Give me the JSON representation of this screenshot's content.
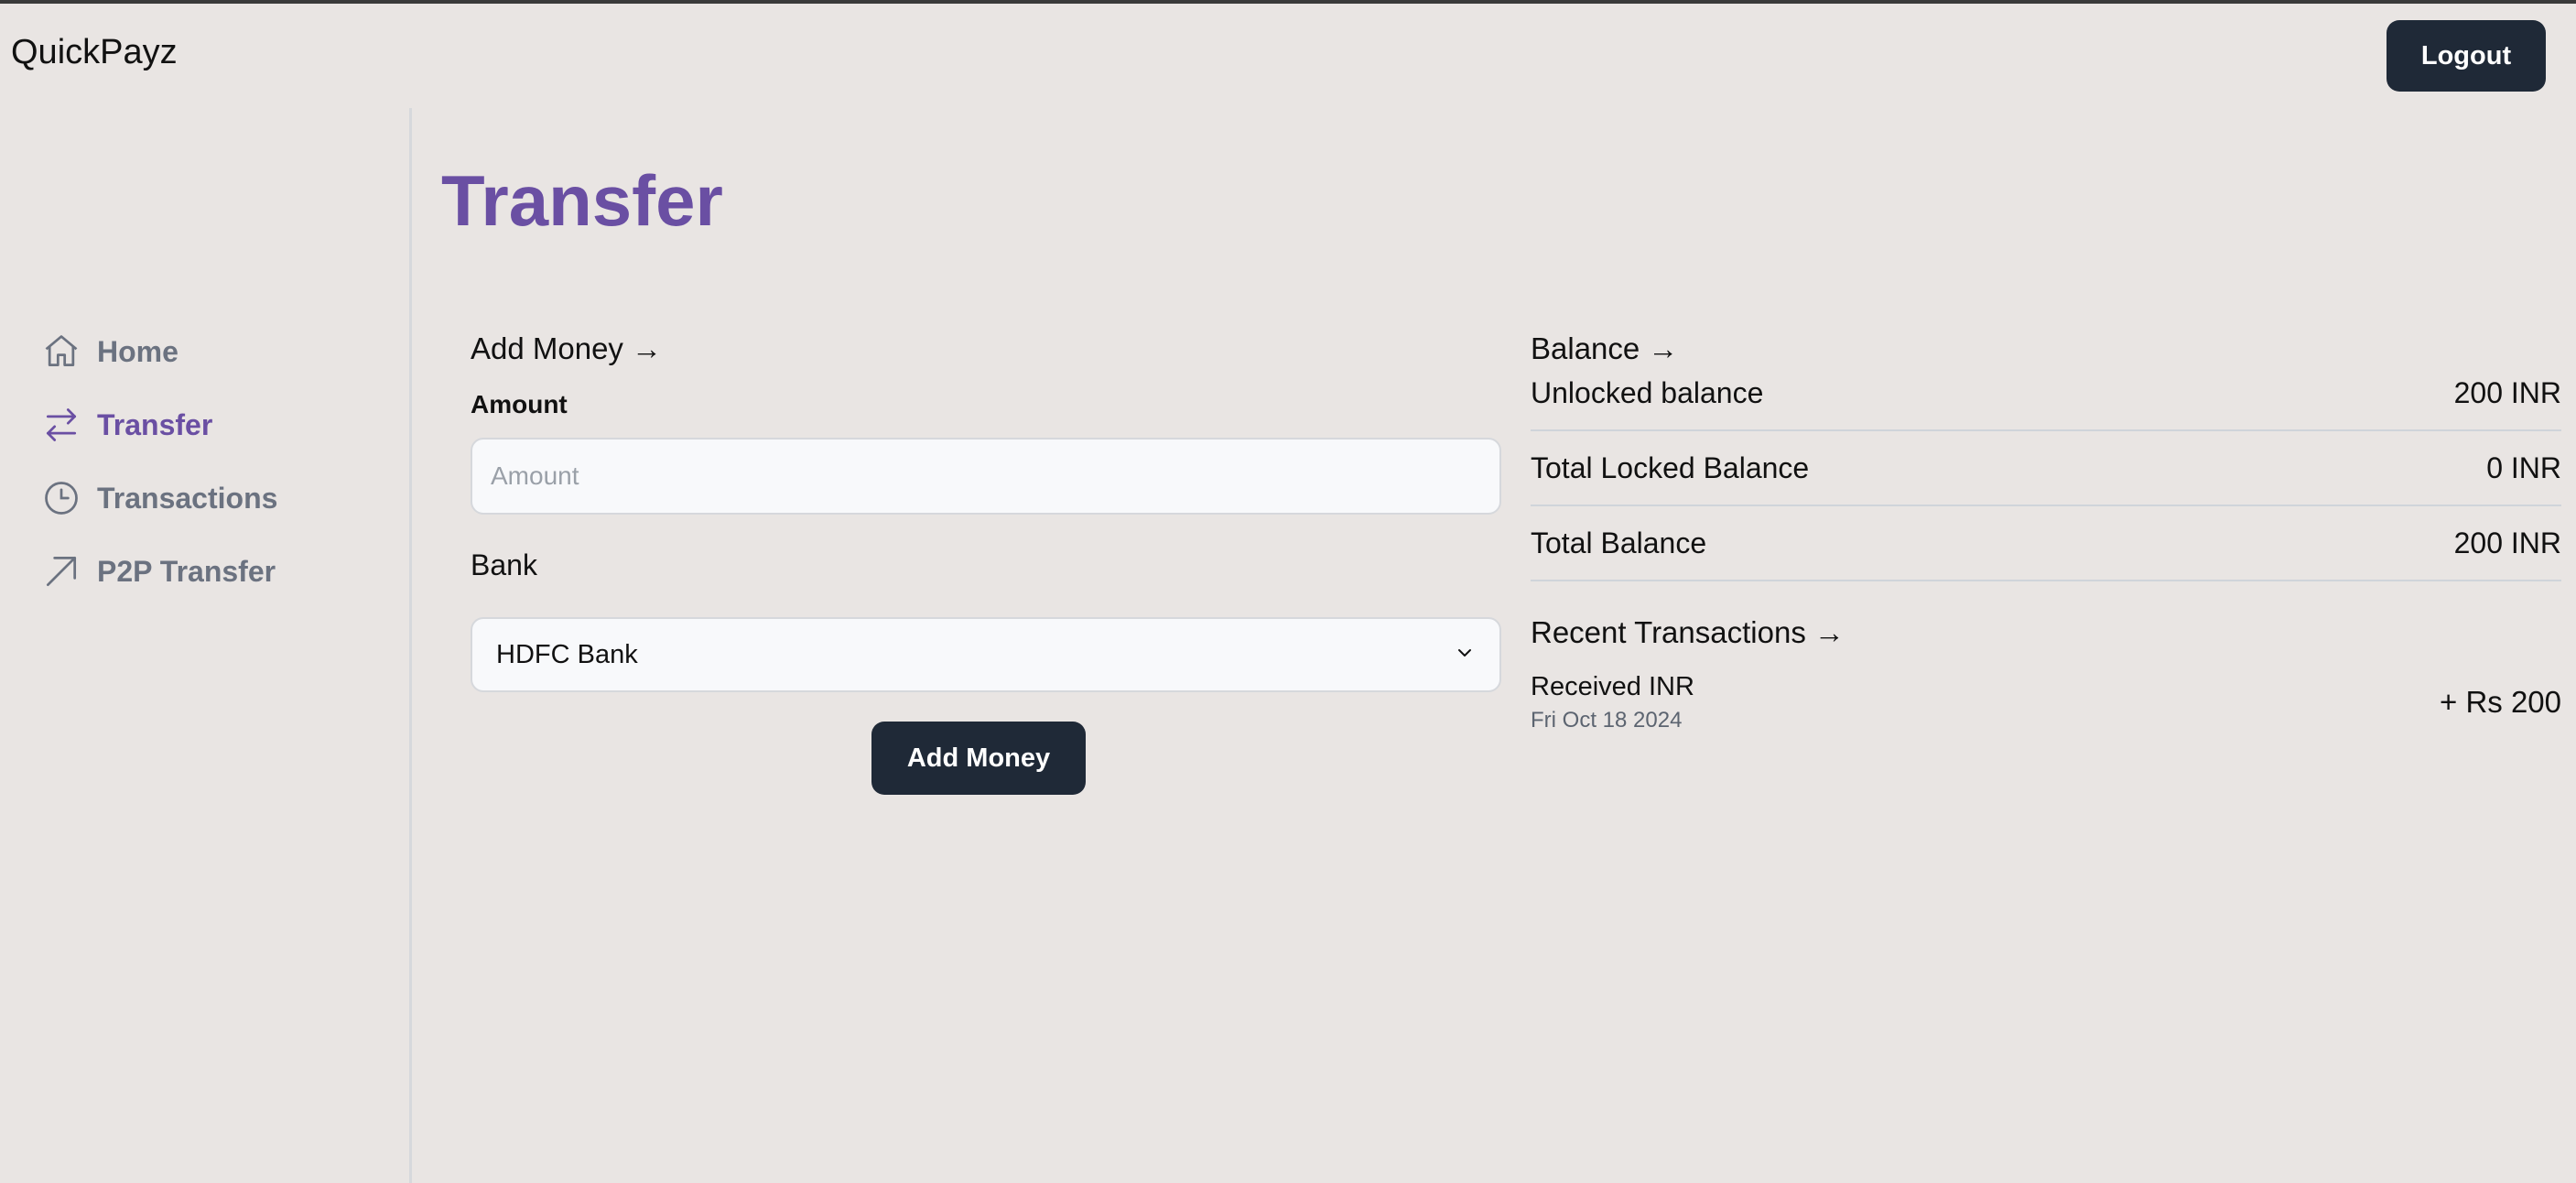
{
  "header": {
    "brand": "QuickPayz",
    "logout_label": "Logout"
  },
  "sidebar": {
    "items": [
      {
        "label": "Home",
        "icon": "home-icon",
        "active": false
      },
      {
        "label": "Transfer",
        "icon": "transfer-arrows-icon",
        "active": true
      },
      {
        "label": "Transactions",
        "icon": "clock-icon",
        "active": false
      },
      {
        "label": "P2P Transfer",
        "icon": "arrow-up-right-icon",
        "active": false
      }
    ]
  },
  "main": {
    "title": "Transfer",
    "add_money": {
      "title": "Add Money →",
      "amount_label": "Amount",
      "amount_placeholder": "Amount",
      "bank_label": "Bank",
      "bank_selected": "HDFC Bank",
      "submit_label": "Add Money"
    },
    "balance": {
      "title": "Balance →",
      "rows": [
        {
          "label": "Unlocked balance",
          "value": "200 INR"
        },
        {
          "label": "Total Locked Balance",
          "value": "0 INR"
        },
        {
          "label": "Total Balance",
          "value": "200 INR"
        }
      ]
    },
    "recent_transactions": {
      "title": "Recent Transactions →",
      "items": [
        {
          "label": "Received INR",
          "date": "Fri Oct 18 2024",
          "amount": "+ Rs 200"
        }
      ]
    }
  },
  "colors": {
    "background": "#e9e5e3",
    "accent": "#6a4fa3",
    "button": "#1f2937",
    "muted_nav": "#6b7280"
  }
}
